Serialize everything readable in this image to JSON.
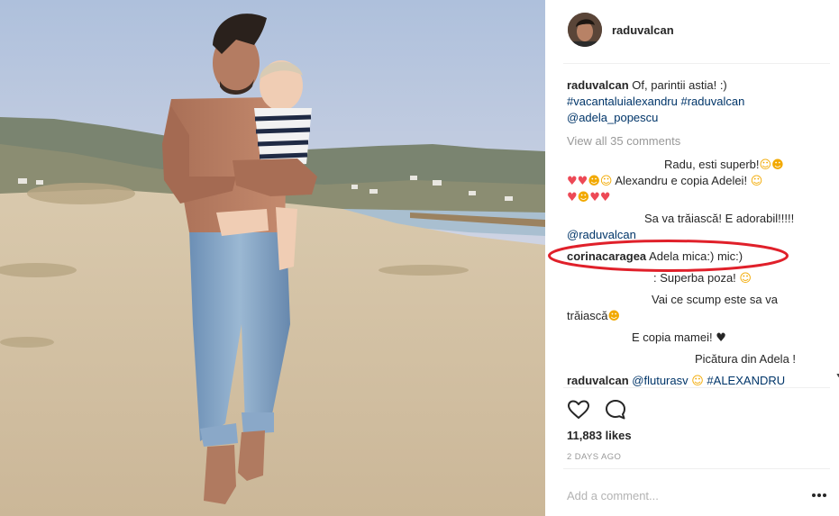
{
  "post": {
    "username": "raduvalcan",
    "caption": {
      "username": "raduvalcan",
      "text": "Of, parintii astia! :)",
      "hashtag1": "#vacantaluialexandru",
      "hashtag2": "#raduvalcan",
      "mention": "@adela_popescu"
    },
    "view_all": "View all 35 comments",
    "comments": {
      "c1_text": "Radu, esti superb!",
      "c2_text": "Alexandru e copia Adelei!",
      "c3_text": "Sa va trăiască! E adorabil!!!!!",
      "c3_mention": "@raduvalcan",
      "c4_user": "corinacaragea",
      "c4_text": "Adela mica:) mic:)",
      "c5_text": ": Superba poza!",
      "c6_text": "Vai ce scump este sa va",
      "c6_text2": "trăiască",
      "c7_text": "E copia mamei!",
      "c8_text": "Picătura din Adela !",
      "c9_user": "raduvalcan",
      "c9_mention": "@fluturаsv",
      "c9_hashtag": "#ALEXANDRU"
    },
    "likes": "11,883 likes",
    "time_ago": "2 DAYS AGO",
    "add_comment_placeholder": "Add a comment...",
    "icons": {
      "like": "heart-outline-icon",
      "comment": "speech-bubble-icon",
      "more": "more-options-icon"
    }
  },
  "colors": {
    "link": "#003569",
    "muted": "#999999",
    "text": "#262626",
    "highlight": "#e0202a"
  }
}
